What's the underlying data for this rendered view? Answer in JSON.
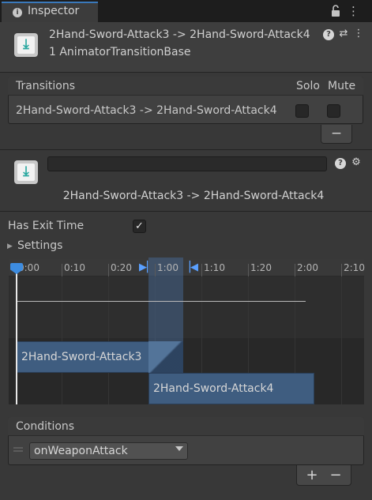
{
  "tab": {
    "label": "Inspector",
    "icon": "info-icon"
  },
  "header": {
    "title": "2Hand-Sword-Attack3 -> 2Hand-Sword-Attack4",
    "subtitle": "1 AnimatorTransitionBase",
    "icon": "transition-icon"
  },
  "transitions_list": {
    "header": "Transitions",
    "col_solo": "Solo",
    "col_mute": "Mute",
    "rows": [
      {
        "label": "2Hand-Sword-Attack3 -> 2Hand-Sword-Attack4",
        "solo": false,
        "mute": false
      }
    ],
    "remove_label": "−"
  },
  "transition": {
    "name_value": "",
    "title": "2Hand-Sword-Attack3 -> 2Hand-Sword-Attack4"
  },
  "settings": {
    "has_exit_time_label": "Has Exit Time",
    "has_exit_time": true,
    "check_glyph": "✓",
    "settings_label": "Settings"
  },
  "timeline": {
    "ticks": [
      "0:00",
      "0:10",
      "0:20",
      "1:00",
      "1:10",
      "1:20",
      "2:00",
      "2:10"
    ],
    "clip_a": "2Hand-Sword-Attack3",
    "clip_b": "2Hand-Sword-Attack4"
  },
  "conditions": {
    "header": "Conditions",
    "items": [
      {
        "parameter": "onWeaponAttack"
      }
    ],
    "add_label": "+",
    "remove_label": "−"
  },
  "colors": {
    "panel": "#383838",
    "accent": "#3a79bb",
    "clip": "#3f5d80",
    "selection": "#496ea0"
  }
}
